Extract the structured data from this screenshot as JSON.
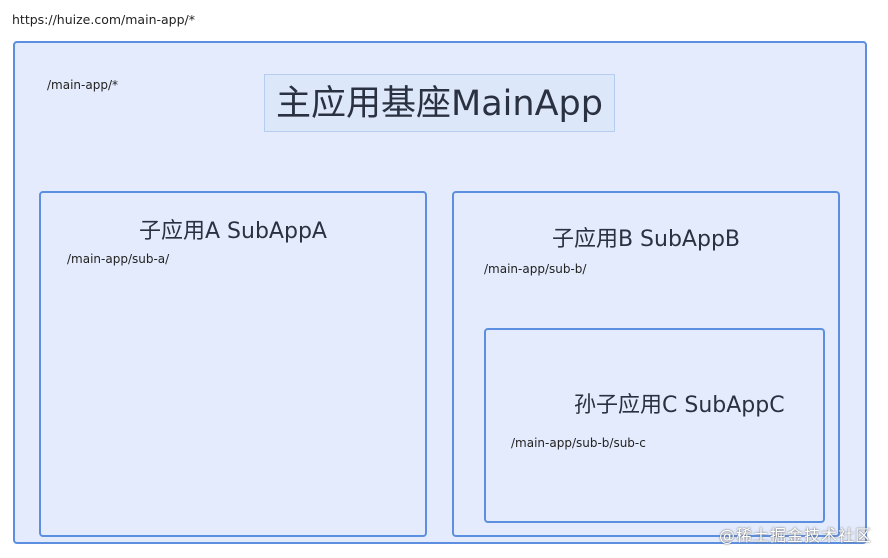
{
  "page_url": "https://huize.com/main-app/*",
  "main_app": {
    "title": "主应用基座MainApp",
    "path": "/main-app/*"
  },
  "sub_app_a": {
    "title": "子应用A SubAppA",
    "path": "/main-app/sub-a/"
  },
  "sub_app_b": {
    "title": "子应用B SubAppB",
    "path": "/main-app/sub-b/"
  },
  "sub_app_c": {
    "title": "孙子应用C SubAppC",
    "path": "/main-app/sub-b/sub-c"
  },
  "watermark": "@稀土掘金技术社区",
  "colors": {
    "box_fill": "#e3ebfc",
    "box_border": "#5d8fe0"
  }
}
